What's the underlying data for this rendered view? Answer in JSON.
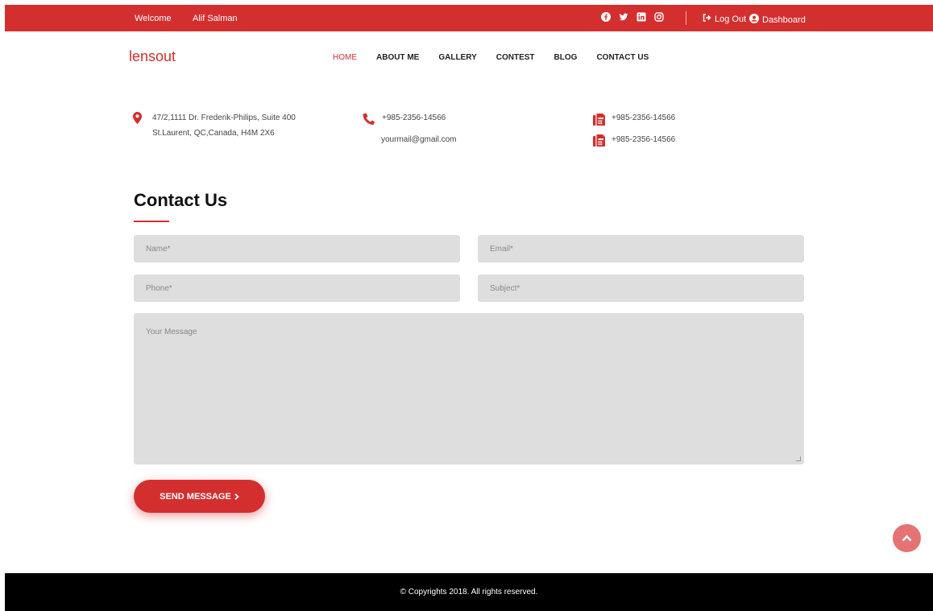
{
  "topbar": {
    "welcome": "Welcome",
    "username": "Alif Salman",
    "socials": [
      "facebook-icon",
      "twitter-icon",
      "linkedin-icon",
      "instagram-icon"
    ],
    "logout": "Log Out",
    "dashboard": "Dashboard"
  },
  "header": {
    "logo": "lensout",
    "nav": [
      {
        "label": "HOME",
        "active": true
      },
      {
        "label": "ABOUT ME"
      },
      {
        "label": "GALLERY"
      },
      {
        "label": "CONTEST"
      },
      {
        "label": "BLOG"
      },
      {
        "label": "CONTACT US"
      }
    ]
  },
  "contact_info": {
    "address_line1": "47/2,1111 Dr. Frederik-Philips, Suite 400",
    "address_line2": "St.Laurent, QC,Canada, H4M 2X6",
    "phone": "+985-2356-14566",
    "email": "yourmail@gmail.com",
    "fax1": "+985-2356-14566",
    "fax2": "+985-2356-14566"
  },
  "form": {
    "title": "Contact Us",
    "name_placeholder": "Name*",
    "email_placeholder": "Email*",
    "phone_placeholder": "Phone*",
    "subject_placeholder": "Subject*",
    "message_placeholder": "Your Message",
    "send_label": "SEND MESSAGE"
  },
  "footer": {
    "copyright": "© Copyrights 2018. All rights reserved."
  },
  "colors": {
    "accent": "#d42f2f",
    "field_bg": "#dedede",
    "footer_bg": "#000000"
  }
}
